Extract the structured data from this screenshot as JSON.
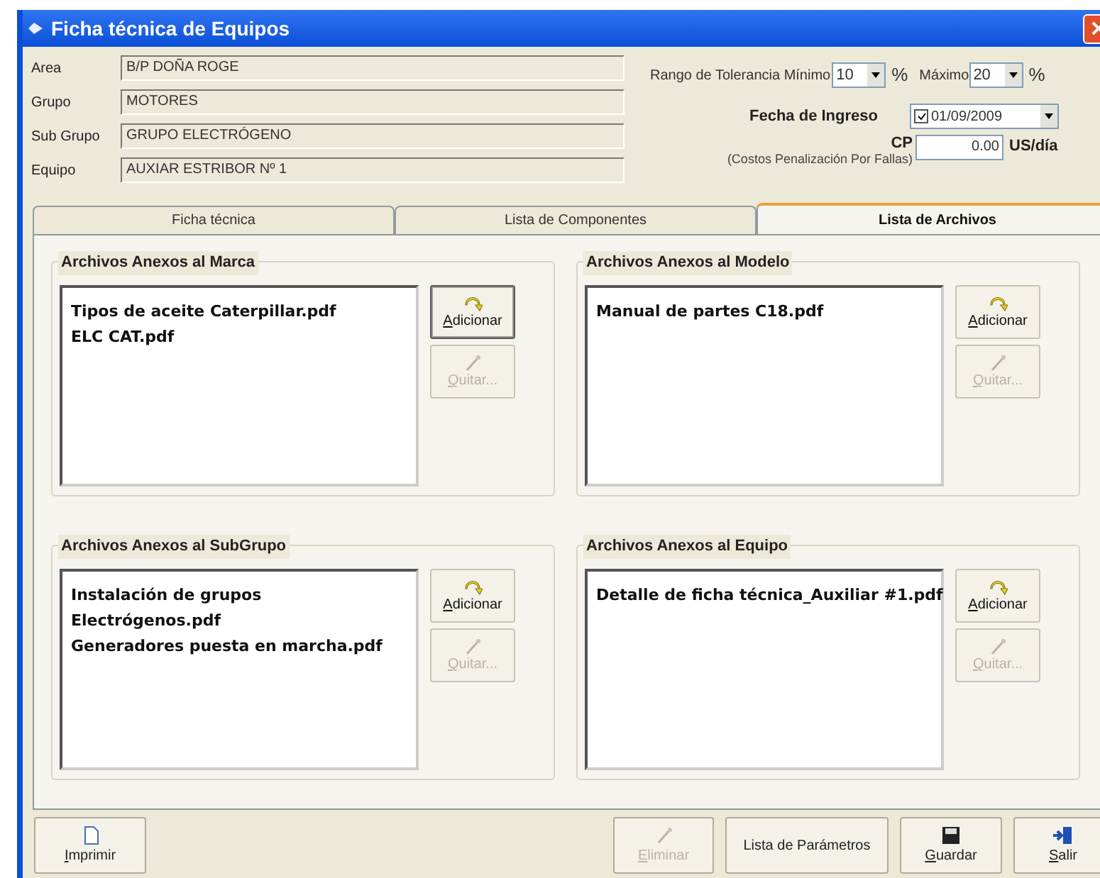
{
  "window": {
    "title": "Ficha técnica de Equipos"
  },
  "fields": [
    {
      "label": "Area",
      "value": "B/P DOÑA ROGE"
    },
    {
      "label": "Grupo",
      "value": "MOTORES"
    },
    {
      "label": "Sub Grupo",
      "value": "GRUPO ELECTRÓGENO"
    },
    {
      "label": "Equipo",
      "value": "AUXIAR ESTRIBOR Nº 1"
    }
  ],
  "tolerance": {
    "label": "Rango de Tolerancia Mínimo",
    "min": "10",
    "min_unit": "%",
    "max_label": "Máximo",
    "max": "20",
    "max_unit": "%"
  },
  "entry_date": {
    "label": "Fecha de Ingreso",
    "checked": true,
    "value": "01/09/2009"
  },
  "cp": {
    "label": "CP",
    "sublabel": "(Costos Penalización Por Fallas)",
    "value": "0.00",
    "unit": "US/día"
  },
  "tabs": [
    {
      "label": "Ficha técnica",
      "selected": false
    },
    {
      "label": "Lista de Componentes",
      "selected": false
    },
    {
      "label": "Lista de Archivos",
      "selected": true
    }
  ],
  "groups": [
    {
      "title": "Archivos Anexos al Marca",
      "files": [
        "Tipos de aceite Caterpillar.pdf",
        "ELC CAT.pdf"
      ],
      "buttons": [
        {
          "kind": "add",
          "label": "Adicionar",
          "disabled": false,
          "focused": true
        },
        {
          "kind": "remove",
          "label": "Quitar...",
          "disabled": true,
          "focused": false
        }
      ]
    },
    {
      "title": "Archivos Anexos al Modelo",
      "files": [
        "Manual de partes C18.pdf"
      ],
      "buttons": [
        {
          "kind": "add",
          "label": "Adicionar",
          "disabled": false,
          "focused": false
        },
        {
          "kind": "remove",
          "label": "Quitar...",
          "disabled": true,
          "focused": false
        }
      ]
    },
    {
      "title": "Archivos Anexos al SubGrupo",
      "files": [
        "Instalación de grupos",
        "Electrógenos.pdf",
        "Generadores puesta en marcha.pdf"
      ],
      "buttons": [
        {
          "kind": "add",
          "label": "Adicionar",
          "disabled": false,
          "focused": false
        },
        {
          "kind": "remove",
          "label": "Quitar...",
          "disabled": true,
          "focused": false
        }
      ]
    },
    {
      "title": "Archivos Anexos al Equipo",
      "files": [
        "Detalle de ficha técnica_Auxiliar #1.pdf"
      ],
      "buttons": [
        {
          "kind": "add",
          "label": "Adicionar",
          "disabled": false,
          "focused": false
        },
        {
          "kind": "remove",
          "label": "Quitar...",
          "disabled": true,
          "focused": false
        }
      ]
    }
  ],
  "footer_buttons": [
    {
      "kind": "print",
      "label": "Imprimir",
      "disabled": false
    },
    {
      "kind": "delete",
      "label": "Eliminar",
      "disabled": true
    },
    {
      "kind": "text",
      "label": "Lista de Parámetros",
      "disabled": false
    },
    {
      "kind": "save",
      "label": "Guardar",
      "disabled": false
    },
    {
      "kind": "exit",
      "label": "Salir",
      "disabled": false
    }
  ]
}
